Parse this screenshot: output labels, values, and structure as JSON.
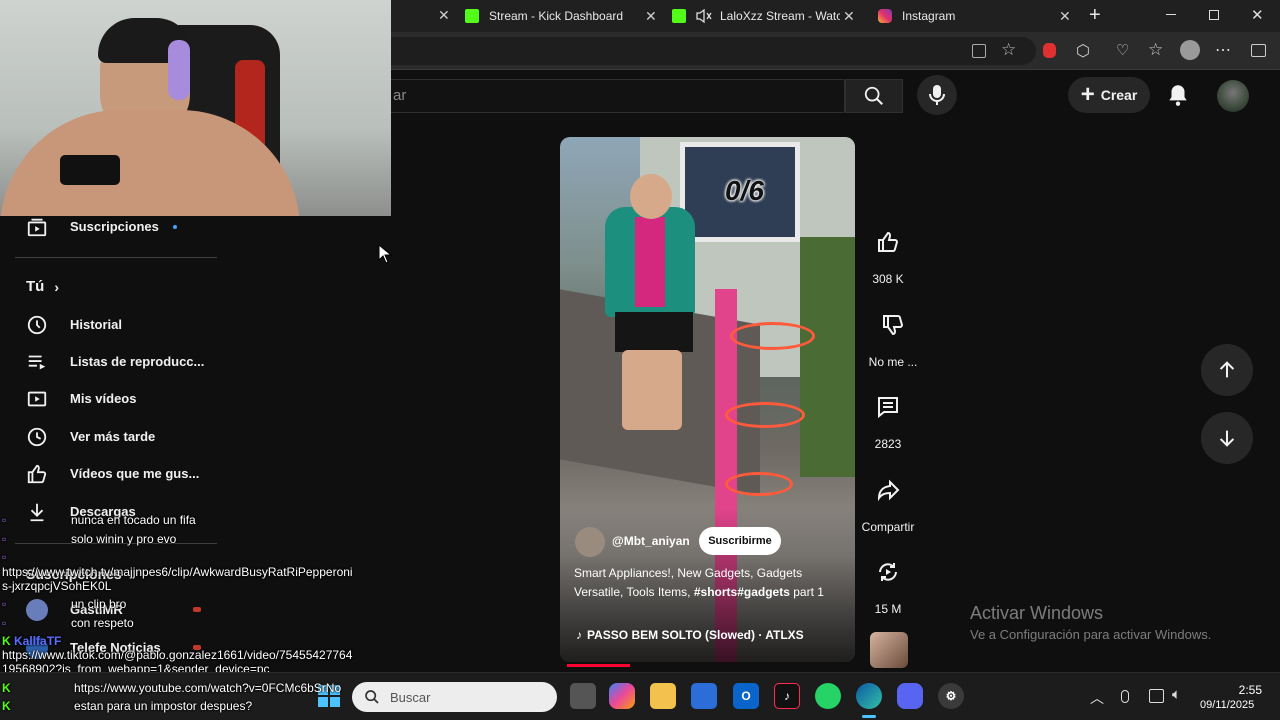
{
  "browser": {
    "tabs": [
      {
        "label": "Stream - Kick Dashboard"
      },
      {
        "label": "LaloXzz Stream - Watch L"
      },
      {
        "label": "Instagram"
      }
    ]
  },
  "youtube": {
    "search_placeholder": "ar",
    "create_label": "Crear",
    "sidebar": {
      "subscriptions": "Suscripciones",
      "you_label": "Tú",
      "items": [
        {
          "label": "Historial"
        },
        {
          "label": "Listas de reproducc..."
        },
        {
          "label": "Mis vídeos"
        },
        {
          "label": "Ver más tarde"
        },
        {
          "label": "Vídeos que me gus..."
        },
        {
          "label": "Descargas"
        }
      ],
      "section_title": "Suscripciones",
      "channels": [
        {
          "label": "GastiMR"
        },
        {
          "label": "Telefe Noticias"
        }
      ]
    },
    "short": {
      "overlay_text": "0/6",
      "channel": "@Mbt_aniyan",
      "subscribe": "Suscribirme",
      "description_plain": "Smart Appliances!, New Gadgets, Gadgets Versatile, Tools Items,",
      "description_tags": "#shorts#gadgets",
      "description_tail": "part 1",
      "music": "PASSO BEM SOLTO (Slowed) · ATLXS"
    },
    "actions": {
      "likes": "308 K",
      "dislike": "No me ...",
      "comments": "2823",
      "share": "Compartir",
      "remix": "15 M"
    }
  },
  "windows_activation": {
    "title": "Activar Windows",
    "subtitle": "Ve a Configuración para activar Windows."
  },
  "chat": [
    {
      "user": "",
      "text": "nunca en tocado un fifa"
    },
    {
      "user": "",
      "text": "solo winin y pro evo"
    },
    {
      "user": "",
      "text": ""
    },
    {
      "user": "",
      "text": "https://www.twitch.tv/majjnpes6/clip/AwkwardBusyRatRiPepperoni"
    },
    {
      "user": "",
      "text": "s-jxrzqpcjVSohEK0L"
    },
    {
      "user": "",
      "text": "un clip bro"
    },
    {
      "user": "",
      "text": "con respeto"
    },
    {
      "user": "KallfaTF",
      "text": ""
    },
    {
      "user": "",
      "text": "https://www.tiktok.com/@pablo.gonzalez1661/video/75455427764"
    },
    {
      "user": "",
      "text": "19568902?is_from_webapp=1&sender_device=pc"
    },
    {
      "user": "",
      "text": "https://www.youtube.com/watch?v=0FCMc6bSrNo"
    },
    {
      "user": "",
      "text": "estan para un impostor despues?"
    }
  ],
  "taskbar": {
    "search_placeholder": "Buscar",
    "time": "2:55",
    "date": "09/11/2025"
  }
}
